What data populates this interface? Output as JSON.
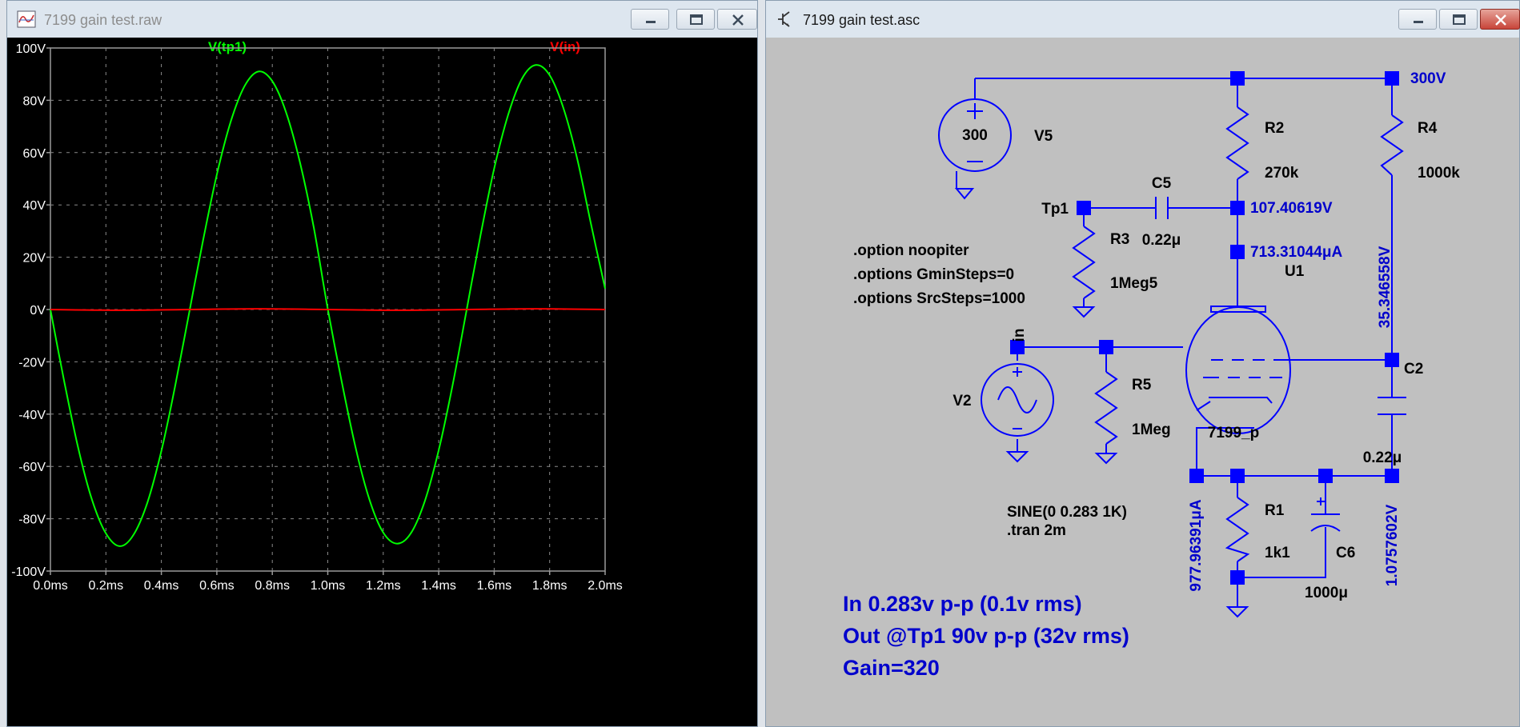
{
  "waveform_window": {
    "title": "7199 gain test.raw",
    "icon": "waveform-icon"
  },
  "schematic_window": {
    "title": "7199 gain test.asc",
    "icon": "schematic-icon"
  },
  "window_controls": {
    "minimize": "minimize-icon",
    "maximize": "maximize-icon",
    "close": "close-icon"
  },
  "colors": {
    "plot_background": "#000000",
    "trace_tp1": "#00ff00",
    "trace_in": "#ff0000",
    "schematic_background": "#c0c0c0",
    "schematic_wire": "#0000ff",
    "schematic_label": "#0000cc"
  },
  "chart_data": {
    "type": "line",
    "legend_position": "top",
    "grid": true,
    "xlim": [
      0,
      2.0
    ],
    "ylim": [
      -100,
      100
    ],
    "x_ticks": [
      "0.0ms",
      "0.2ms",
      "0.4ms",
      "0.6ms",
      "0.8ms",
      "1.0ms",
      "1.2ms",
      "1.4ms",
      "1.6ms",
      "1.8ms",
      "2.0ms"
    ],
    "y_ticks": [
      "100V",
      "80V",
      "60V",
      "40V",
      "20V",
      "0V",
      "-20V",
      "-40V",
      "-60V",
      "-80V",
      "-100V"
    ],
    "series": [
      {
        "name": "V(tp1)",
        "color": "#00ff00",
        "x": [
          0,
          0.05,
          0.1,
          0.15,
          0.2,
          0.25,
          0.3,
          0.35,
          0.4,
          0.45,
          0.5,
          0.55,
          0.6,
          0.65,
          0.7,
          0.75,
          0.8,
          0.85,
          0.9,
          0.95,
          1.0,
          1.05,
          1.1,
          1.15,
          1.2,
          1.25,
          1.3,
          1.35,
          1.4,
          1.45,
          1.5,
          1.55,
          1.6,
          1.65,
          1.7,
          1.75,
          1.8,
          1.85,
          1.9,
          1.95,
          2.0
        ],
        "y": [
          0,
          -27.6,
          -52.9,
          -72.8,
          -85.6,
          -90.5,
          -86.1,
          -73.7,
          -54.1,
          -29.1,
          -1.3,
          26.3,
          51.6,
          71.8,
          85.4,
          91.0,
          87.3,
          75.3,
          56.1,
          31.1,
          0.2,
          -27.4,
          -52.7,
          -72.6,
          -85.3,
          -89.5,
          -85.5,
          -73.2,
          -53.8,
          -29.0,
          -0.5,
          28.0,
          53.9,
          74.3,
          88.2,
          93.5,
          89.6,
          76.9,
          57.3,
          32.2,
          8.0
        ]
      },
      {
        "name": "V(in)",
        "color": "#ff0000",
        "x": [
          0,
          0.25,
          0.5,
          0.75,
          1.0,
          1.25,
          1.5,
          1.75,
          2.0
        ],
        "y": [
          0,
          -0.283,
          0,
          0.283,
          0,
          -0.283,
          0,
          0.283,
          0
        ]
      }
    ]
  },
  "schematic": {
    "supply_voltage": "300V",
    "v5_value": "300",
    "v5_name": "V5",
    "r2_name": "R2",
    "r2_value": "270k",
    "r4_name": "R4",
    "r4_value": "1000k",
    "c5_name": "C5",
    "c5_value": "0.22μ",
    "tp1_label": "Tp1",
    "plate_voltage": "107.40619V",
    "plate_current": "713.31044μA",
    "r3_name": "R3",
    "r3_value": "1Meg5",
    "u1_name": "U1",
    "screen_voltage": "35.346558V",
    "c2_name": "C2",
    "c2_value": "0.22μ",
    "in_label": "in",
    "r5_name": "R5",
    "r5_value": "1Meg",
    "v2_name": "V2",
    "tube_model": "7199_p",
    "r1_name": "R1",
    "r1_value": "1k1",
    "c6_name": "C6",
    "c6_value": "1000μ",
    "cathode_current": "977.96391μA",
    "cathode_voltage": "1.0757602V",
    "sine_spec": "SINE(0 0.283 1K)",
    "tran_spec": ".tran 2m",
    "option_1": ".option noopiter",
    "option_2": ".options GminSteps=0",
    "option_3": ".options SrcSteps=1000",
    "note_in": "In 0.283v p-p (0.1v rms)",
    "note_out": "Out @Tp1 90v p-p (32v rms)",
    "note_gain": "Gain=320"
  }
}
